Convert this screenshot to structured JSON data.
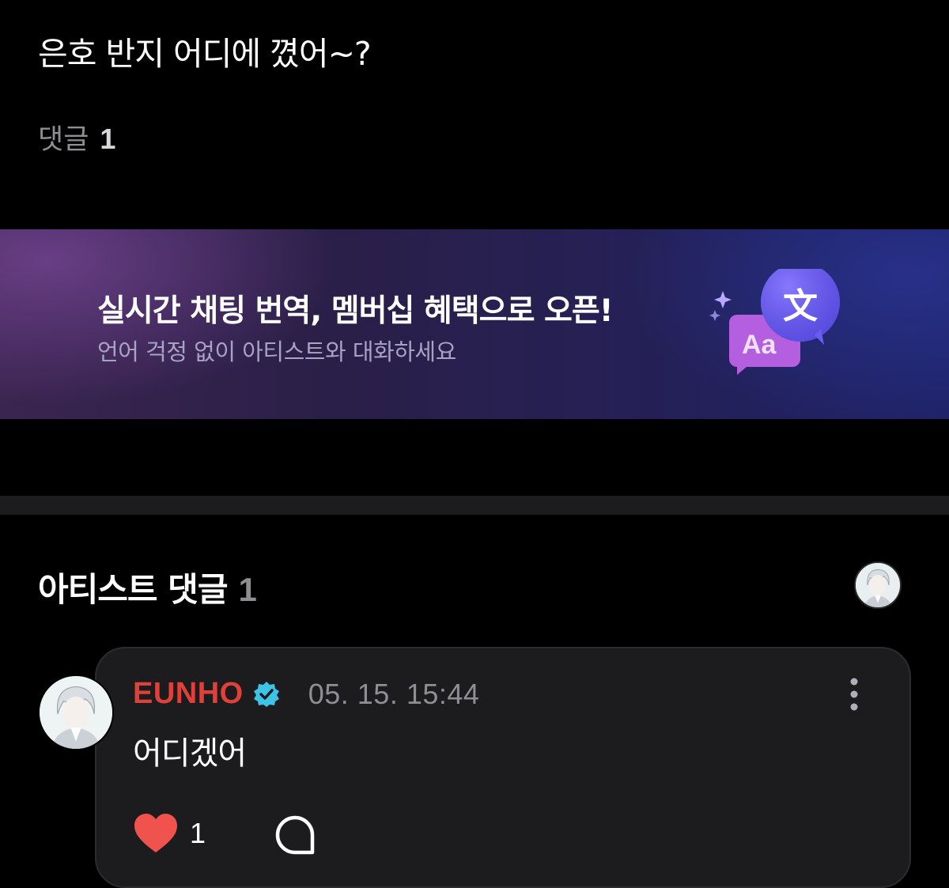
{
  "post": {
    "text": "은호 반지 어디에 꼈어~?",
    "comments_label": "댓글",
    "comments_count": "1"
  },
  "banner": {
    "title": "실시간 채팅 번역, 멤버십 혜택으로 오픈!",
    "subtitle": "언어 걱정 없이 아티스트와 대화하세요",
    "icon": "translate-bubbles-icon",
    "icon_glyph_latin": "Aa",
    "icon_glyph_cjk": "文",
    "colors": {
      "latin_bubble": "#b45fe0",
      "cjk_bubble": "#6a5cf0",
      "sparkle": "#b9a8ff"
    }
  },
  "artist_section": {
    "title": "아티스트 댓글",
    "count": "1"
  },
  "comment": {
    "author": "EUNHO",
    "verified": true,
    "timestamp": "05. 15. 15:44",
    "text": "어디겠어",
    "likes": "1",
    "liked": true
  },
  "colors": {
    "background": "#000000",
    "card": "#1c1c1e",
    "author_name": "#e0403a",
    "verified_badge": "#3ec3e6",
    "heart": "#f0524e",
    "muted_text": "#8e8e93"
  }
}
